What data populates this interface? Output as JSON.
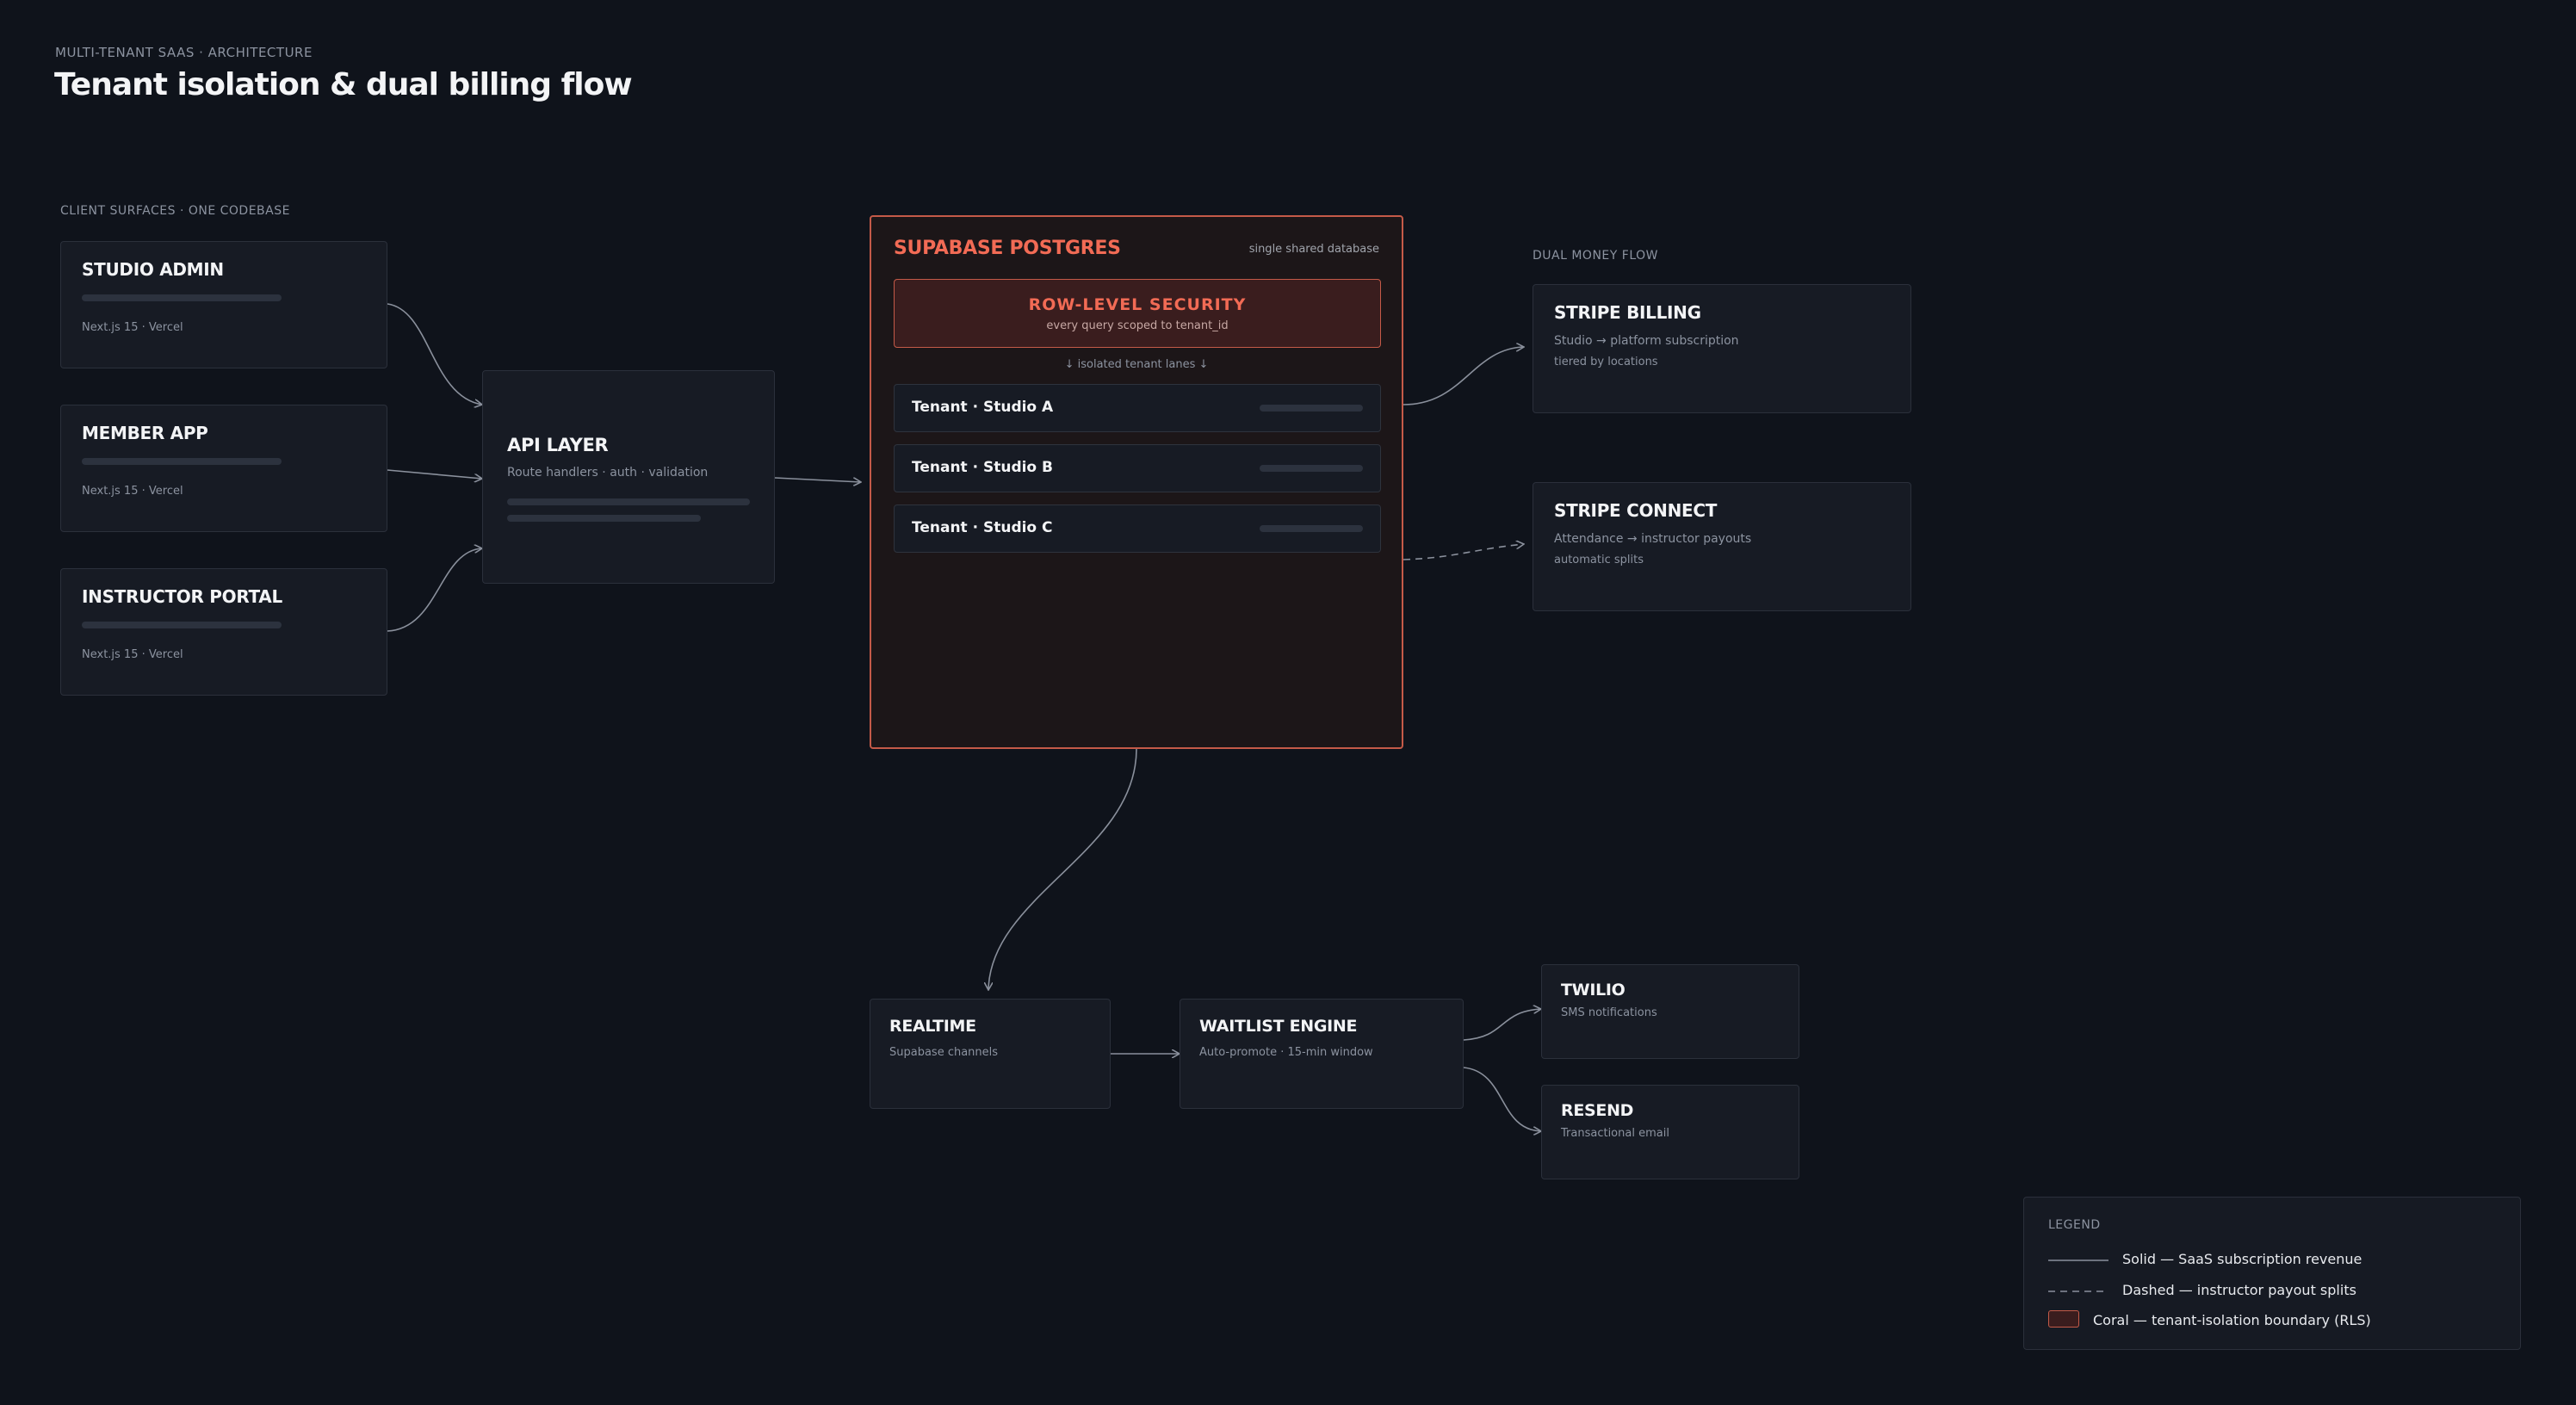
{
  "header": {
    "eyebrow": "MULTI-TENANT SAAS · ARCHITECTURE",
    "title": "Tenant isolation & dual billing flow"
  },
  "clients": {
    "label": "CLIENT SURFACES · ONE CODEBASE",
    "items": [
      {
        "title": "STUDIO ADMIN",
        "sub": "Next.js 15 · Vercel"
      },
      {
        "title": "MEMBER APP",
        "sub": "Next.js 15 · Vercel"
      },
      {
        "title": "INSTRUCTOR PORTAL",
        "sub": "Next.js 15 · Vercel"
      }
    ]
  },
  "api": {
    "title": "API LAYER",
    "sub": "Route handlers · auth · validation"
  },
  "database": {
    "title": "SUPABASE POSTGRES",
    "note": "single shared database",
    "rls_title": "ROW-LEVEL SECURITY",
    "rls_sub": "every query scoped to tenant_id",
    "lanes_label": "↓ isolated tenant lanes ↓",
    "lanes": [
      "Tenant · Studio A",
      "Tenant · Studio B",
      "Tenant · Studio C"
    ]
  },
  "money": {
    "label": "DUAL MONEY FLOW",
    "billing": {
      "title": "STRIPE BILLING",
      "line1": "Studio → platform subscription",
      "line2": "tiered by locations"
    },
    "connect": {
      "title": "STRIPE CONNECT",
      "line1": "Attendance → instructor payouts",
      "line2": "automatic splits"
    }
  },
  "services": {
    "realtime": {
      "title": "REALTIME",
      "sub": "Supabase channels"
    },
    "waitlist": {
      "title": "WAITLIST ENGINE",
      "sub": "Auto-promote · 15-min window"
    },
    "twilio": {
      "title": "TWILIO",
      "sub": "SMS notifications"
    },
    "resend": {
      "title": "RESEND",
      "sub": "Transactional email"
    }
  },
  "legend": {
    "title": "LEGEND",
    "solid": "Solid — SaaS subscription revenue",
    "dashed": "Dashed — instructor payout splits",
    "coral": "Coral — tenant-isolation boundary (RLS)"
  },
  "colors": {
    "background": "#0f131b",
    "card": "#171b24",
    "coral": "#f26b55",
    "wire": "#8a909c"
  }
}
